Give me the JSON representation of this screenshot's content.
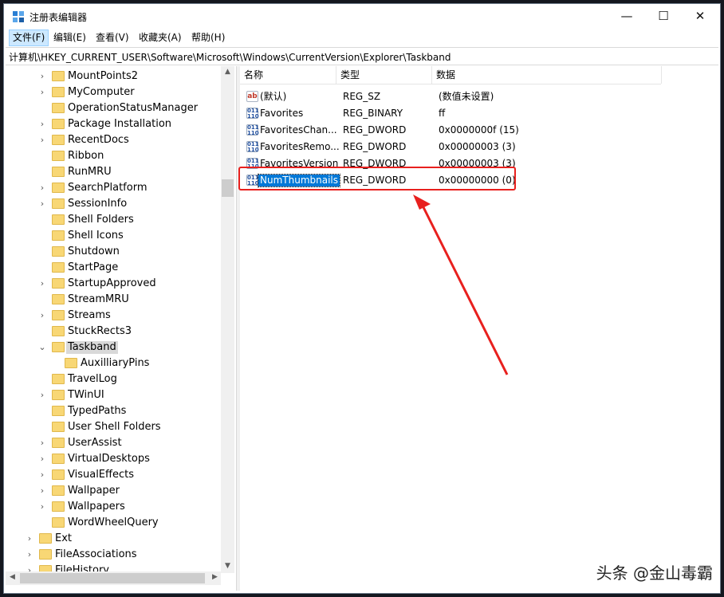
{
  "window": {
    "title": "注册表编辑器",
    "controls": {
      "minimize": "—",
      "maximize": "☐",
      "close": "✕"
    }
  },
  "menu": [
    {
      "label": "文件(F)",
      "active": true
    },
    {
      "label": "编辑(E)"
    },
    {
      "label": "查看(V)"
    },
    {
      "label": "收藏夹(A)"
    },
    {
      "label": "帮助(H)"
    }
  ],
  "address": "计算机\\HKEY_CURRENT_USER\\Software\\Microsoft\\Windows\\CurrentVersion\\Explorer\\Taskband",
  "tree": [
    {
      "label": "MountPoints2",
      "arrow": "›",
      "indent": 1
    },
    {
      "label": "MyComputer",
      "arrow": "›",
      "indent": 1
    },
    {
      "label": "OperationStatusManager",
      "arrow": "",
      "indent": 1
    },
    {
      "label": "Package Installation",
      "arrow": "›",
      "indent": 1
    },
    {
      "label": "RecentDocs",
      "arrow": "›",
      "indent": 1
    },
    {
      "label": "Ribbon",
      "arrow": "",
      "indent": 1
    },
    {
      "label": "RunMRU",
      "arrow": "",
      "indent": 1
    },
    {
      "label": "SearchPlatform",
      "arrow": "›",
      "indent": 1
    },
    {
      "label": "SessionInfo",
      "arrow": "›",
      "indent": 1
    },
    {
      "label": "Shell Folders",
      "arrow": "",
      "indent": 1
    },
    {
      "label": "Shell Icons",
      "arrow": "",
      "indent": 1
    },
    {
      "label": "Shutdown",
      "arrow": "",
      "indent": 1
    },
    {
      "label": "StartPage",
      "arrow": "",
      "indent": 1
    },
    {
      "label": "StartupApproved",
      "arrow": "›",
      "indent": 1
    },
    {
      "label": "StreamMRU",
      "arrow": "",
      "indent": 1
    },
    {
      "label": "Streams",
      "arrow": "›",
      "indent": 1
    },
    {
      "label": "StuckRects3",
      "arrow": "",
      "indent": 1
    },
    {
      "label": "Taskband",
      "arrow": "⌄",
      "indent": 1,
      "selected": true
    },
    {
      "label": "AuxilliaryPins",
      "arrow": "",
      "indent": 2
    },
    {
      "label": "TravelLog",
      "arrow": "",
      "indent": 1
    },
    {
      "label": "TWinUI",
      "arrow": "›",
      "indent": 1
    },
    {
      "label": "TypedPaths",
      "arrow": "",
      "indent": 1
    },
    {
      "label": "User Shell Folders",
      "arrow": "",
      "indent": 1
    },
    {
      "label": "UserAssist",
      "arrow": "›",
      "indent": 1
    },
    {
      "label": "VirtualDesktops",
      "arrow": "›",
      "indent": 1
    },
    {
      "label": "VisualEffects",
      "arrow": "›",
      "indent": 1
    },
    {
      "label": "Wallpaper",
      "arrow": "›",
      "indent": 1
    },
    {
      "label": "Wallpapers",
      "arrow": "›",
      "indent": 1
    },
    {
      "label": "WordWheelQuery",
      "arrow": "",
      "indent": 1
    },
    {
      "label": "Ext",
      "arrow": "›",
      "indent": 0
    },
    {
      "label": "FileAssociations",
      "arrow": "›",
      "indent": 0
    },
    {
      "label": "FileHistory",
      "arrow": "›",
      "indent": 0
    }
  ],
  "columns": {
    "name": "名称",
    "type": "类型",
    "data": "数据"
  },
  "values": [
    {
      "icon": "ab",
      "name": "(默认)",
      "type": "REG_SZ",
      "data": "(数值未设置)"
    },
    {
      "icon": "bin",
      "name": "Favorites",
      "type": "REG_BINARY",
      "data": "ff"
    },
    {
      "icon": "bin",
      "name": "FavoritesChan...",
      "type": "REG_DWORD",
      "data": "0x0000000f (15)"
    },
    {
      "icon": "bin",
      "name": "FavoritesRemo...",
      "type": "REG_DWORD",
      "data": "0x00000003 (3)"
    },
    {
      "icon": "bin",
      "name": "FavoritesVersion",
      "type": "REG_DWORD",
      "data": "0x00000003 (3)"
    },
    {
      "icon": "bin",
      "name": "NumThumbnails",
      "type": "REG_DWORD",
      "data": "0x00000000 (0)",
      "selected": true
    }
  ],
  "annotation": {
    "color": "#e8201e"
  },
  "watermark": "头条 @金山毒霸",
  "colors": {
    "selection": "#0078d7",
    "menu_active": "#cce8ff",
    "folder": "#f8d775"
  }
}
